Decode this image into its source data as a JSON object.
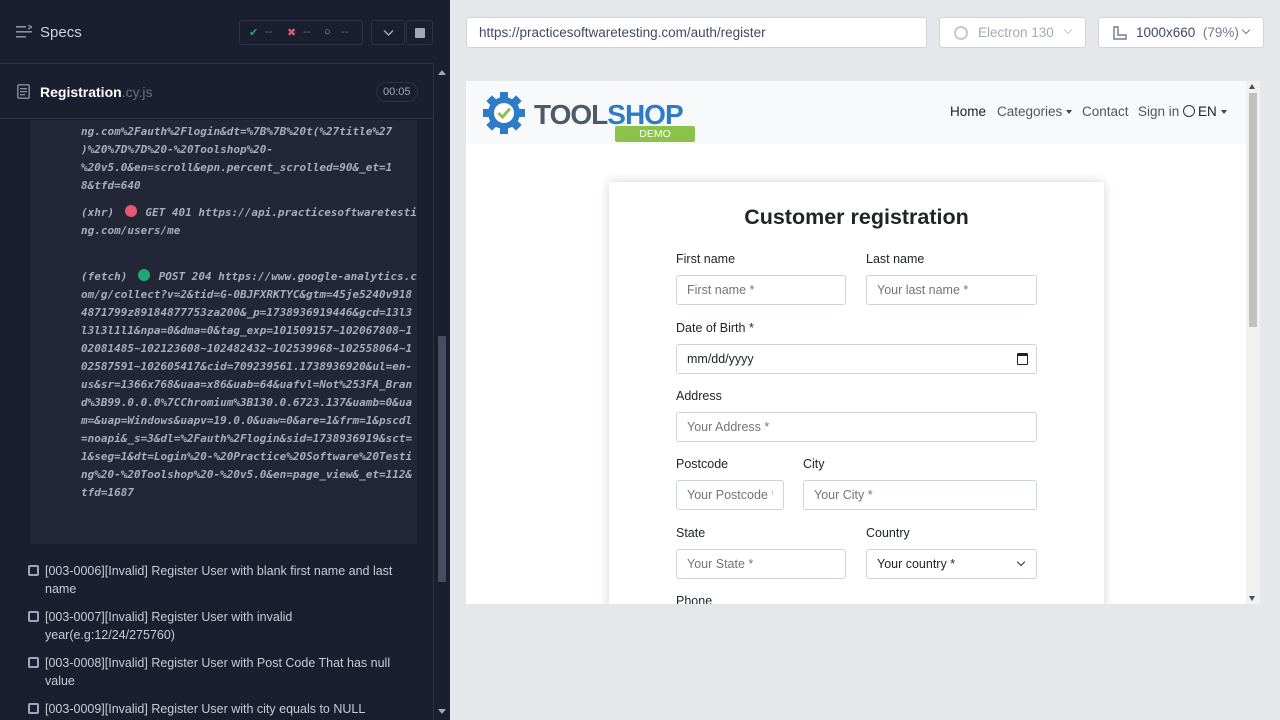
{
  "cypress": {
    "specs_title": "Specs",
    "stats": {
      "passed": "--",
      "failed": "--",
      "pending": "--"
    },
    "spec_file": {
      "name": "Registration",
      "ext": ".cy.js",
      "duration": "00:05"
    },
    "log_lines_top": "ng.com%2Fauth%2Flogin&dt=%7B%7B%20t(%27title%27\n)%20%7D%7D%20-%20Toolshop%20-\n%20v5.0&en=scroll&epn.percent_scrolled=90&_et=1\n8&tfd=640",
    "xhr_entry": {
      "kind": "(xhr)",
      "method": "GET 401",
      "url": "https://api.practicesoftwaretesting.com/users/me"
    },
    "fetch_entry": {
      "kind": "(fetch)",
      "method": "POST 204",
      "url": "https://www.google-analytics.com/g/collect?v=2&tid=G-0BJFXRKTYC&gtm=45je5240v9184871799z89184877753za200&_p=1738936919446&gcd=13l3l3l3l1l1&npa=0&dma=0&tag_exp=101509157~102067808~102081485~102123608~102482432~102539968~102558064~102587591~102605417&cid=709239561.1738936920&ul=en-us&sr=1366x768&uaa=x86&uab=64&uafvl=Not%253FA_Brand%3B99.0.0.0%7CChromium%3B130.0.6723.137&uamb=0&uam=&uap=Windows&uapv=19.0.0&uaw=0&are=1&frm=1&pscdl=noapi&_s=3&dl=%2Fauth%2Flogin&sid=1738936919&sct=1&seg=1&dt=Login%20-%20Practice%20Software%20Testing%20-%20Toolshop%20-%20v5.0&en=page_view&_et=112&tfd=1687"
    },
    "tests": [
      "[003-0006][Invalid] Register User with blank first name and last name",
      "[003-0007][Invalid] Register User with invalid year(e.g:12/24/275760)",
      "[003-0008][Invalid] Register User with Post Code That has null value",
      "[003-0009][Invalid] Register User with city equals to NULL"
    ]
  },
  "browser": {
    "url": "https://practicesoftwaretesting.com/auth/register",
    "engine": "Electron 130",
    "viewport": "1000x660",
    "scale": "(79%)"
  },
  "app": {
    "logo": {
      "part1": "TOOL",
      "part2": "SHOP",
      "badge": "DEMO"
    },
    "nav": {
      "home": "Home",
      "categories": "Categories",
      "contact": "Contact",
      "signin": "Sign in",
      "lang": "EN"
    },
    "form": {
      "title": "Customer registration",
      "first_name": {
        "label": "First name",
        "placeholder": "First name *"
      },
      "last_name": {
        "label": "Last name",
        "placeholder": "Your last name *"
      },
      "dob": {
        "label": "Date of Birth *",
        "value": "mm/dd/yyyy"
      },
      "address": {
        "label": "Address",
        "placeholder": "Your Address *"
      },
      "postcode": {
        "label": "Postcode",
        "placeholder": "Your Postcode *"
      },
      "city": {
        "label": "City",
        "placeholder": "Your City *"
      },
      "state": {
        "label": "State",
        "placeholder": "Your State *"
      },
      "country": {
        "label": "Country",
        "value": "Your country *"
      },
      "phone": {
        "label": "Phone"
      }
    }
  },
  "colors": {
    "panel": "#1b1e2e",
    "pass": "#1fa971",
    "fail": "#e45770",
    "brand": "#2d7cc5",
    "demo": "#8bc34a"
  }
}
